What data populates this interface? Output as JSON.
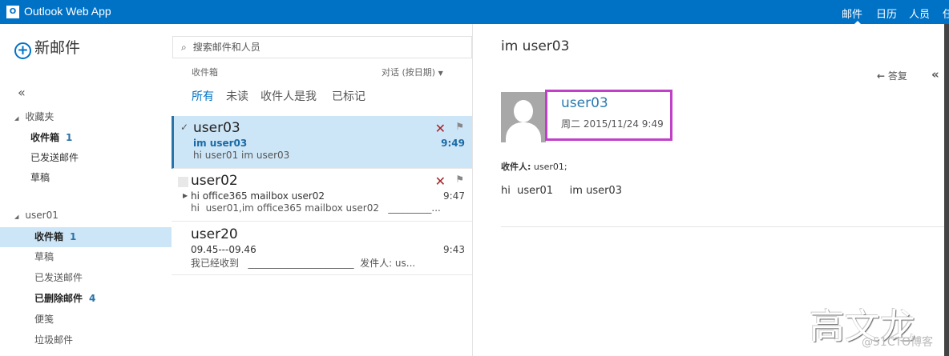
{
  "header": {
    "app_title": "Outlook Web App",
    "nav": [
      "邮件",
      "日历",
      "人员",
      "任"
    ]
  },
  "new_mail": "新邮件",
  "sidebar": {
    "collapse": "«",
    "favorites": {
      "label": "收藏夹",
      "items": [
        {
          "label": "收件箱",
          "count": "1",
          "bold": true
        },
        {
          "label": "已发送邮件"
        },
        {
          "label": "草稿"
        }
      ]
    },
    "account": {
      "label": "user01",
      "items": [
        {
          "label": "收件箱",
          "count": "1",
          "bold": true,
          "selected": true
        },
        {
          "label": "草稿"
        },
        {
          "label": "已发送邮件"
        },
        {
          "label": "已删除邮件",
          "count": "4",
          "bold": true
        },
        {
          "label": "便笺"
        },
        {
          "label": "垃圾邮件"
        }
      ]
    }
  },
  "list": {
    "search_placeholder": "搜索邮件和人员",
    "folder": "收件箱",
    "sort": "对话 (按日期)",
    "filters": [
      "所有",
      "未读",
      "收件人是我",
      "已标记"
    ],
    "messages": [
      {
        "from": "user03",
        "subject": "im user03",
        "preview": "hi user01 im user03",
        "time": "9:49"
      },
      {
        "from": "user02",
        "subject": "hi office365 mailbox user02",
        "preview": "hi  user01,im office365 mailbox user02   _________...",
        "time": "9:47"
      },
      {
        "from": "user20",
        "subject": "09.45---09.46",
        "preview": "我已经收到   ______________________  发件人: us...",
        "time": "9:43"
      }
    ]
  },
  "reading": {
    "subject": "im user03",
    "reply": "答复",
    "sender": "user03",
    "date": "周二 2015/11/24 9:49",
    "to_label": "收件人:",
    "to": "user01;",
    "body": "hi  user01     im user03"
  },
  "watermark": {
    "name": "高文龙",
    "site": "@51CTO博客"
  },
  "colors": {
    "header": "#0072c6",
    "selected": "#cde6f7",
    "highlight_box": "#c040c8"
  }
}
